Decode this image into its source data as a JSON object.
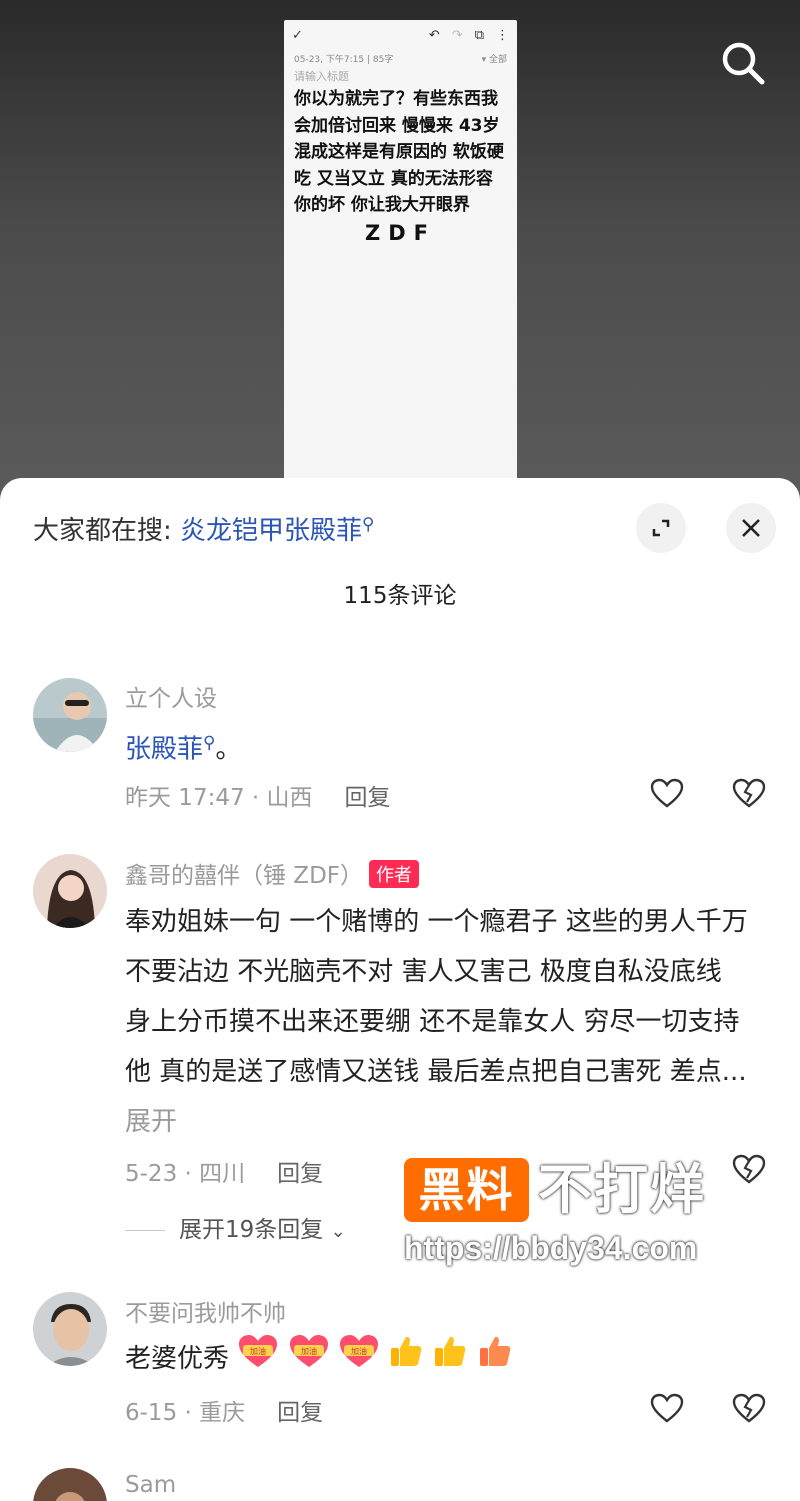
{
  "note": {
    "meta_left": "05-23, 下午7:15  |  85字",
    "meta_right": "全部",
    "title_placeholder": "请输入标题",
    "body": "你以为就完了？有些东西我会加倍讨回来 慢慢来 43岁混成这样是有原因的  软饭硬吃 又当又立 真的无法形容你的坏 你让我大开眼界",
    "signature": "ZDF"
  },
  "sheet": {
    "hot_prefix": "大家都在搜:",
    "hot_keyword": "炎龙铠甲张殿菲",
    "comment_count": "115条评论"
  },
  "comments": [
    {
      "name": "立个人设",
      "link": "张殿菲",
      "suffix": "。",
      "time_location": "昨天 17:47 · 山西",
      "reply_label": "回复"
    },
    {
      "name": "鑫哥的囍伴（锤 ZDF）",
      "badge": "作者",
      "text": "奉劝姐妹一句 一个赌博的 一个瘾君子 这些的男人千万不要沾边 不光脑壳不对 害人又害己 极度自私没底线 身上分币摸不出来还要绷 还不是靠女人 穷尽一切支持他 真的是送了感情又送钱 最后差点把自己害死 差点...",
      "more": "展开",
      "time_location": "5-23 · 四川",
      "reply_label": "回复",
      "expand_replies": "展开19条回复"
    },
    {
      "name": "不要问我帅不帅",
      "text": "老婆优秀",
      "emoji_label": "加油",
      "time_location": "6-15 · 重庆",
      "reply_label": "回复"
    },
    {
      "name": "Sam"
    }
  ],
  "watermark": {
    "box": "黑料",
    "text": "不打烊",
    "url": "https://bbdy34.com"
  }
}
